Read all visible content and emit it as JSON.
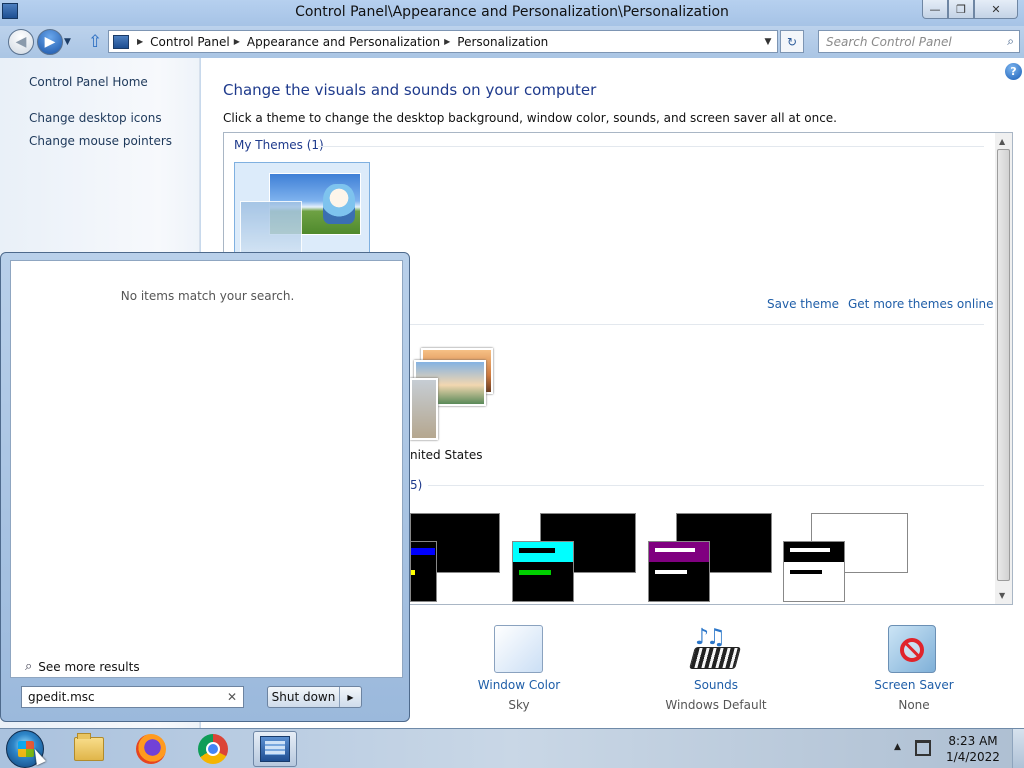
{
  "window": {
    "title": "Control Panel\\Appearance and Personalization\\Personalization",
    "controls": {
      "minimize": "—",
      "maximize": "❐",
      "close": "✕"
    }
  },
  "nav": {
    "breadcrumbs": [
      "Control Panel",
      "Appearance and Personalization",
      "Personalization"
    ],
    "search_placeholder": "Search Control Panel"
  },
  "left_pane": {
    "links": [
      "Control Panel Home",
      "Change desktop icons",
      "Change mouse pointers"
    ]
  },
  "main": {
    "heading": "Change the visuals and sounds on your computer",
    "subheading": "Click a theme to change the desktop background, window color, sounds, and screen saver all at once.",
    "my_themes_title": "My Themes (1)",
    "save_theme": "Save theme",
    "get_more_themes": "Get more themes online",
    "united_states_label": "nited States",
    "basic_group_title_fragment": "5)"
  },
  "bottom": {
    "window_color": {
      "label": "Window Color",
      "value": "Sky"
    },
    "sounds": {
      "label": "Sounds",
      "value": "Windows Default"
    },
    "screen_saver": {
      "label": "Screen Saver",
      "value": "None"
    }
  },
  "start_menu": {
    "no_results": "No items match your search.",
    "see_more": "See more results",
    "search_value": "gpedit.msc",
    "shutdown_label": "Shut down"
  },
  "taskbar": {
    "time": "8:23 AM",
    "date": "1/4/2022"
  },
  "colors": {
    "link_blue": "#1f5ea8",
    "heading_blue": "#1e3a8c",
    "hc_cyan": "#00ffff",
    "hc_purple": "#800080",
    "hc_blue": "#0000ff"
  }
}
